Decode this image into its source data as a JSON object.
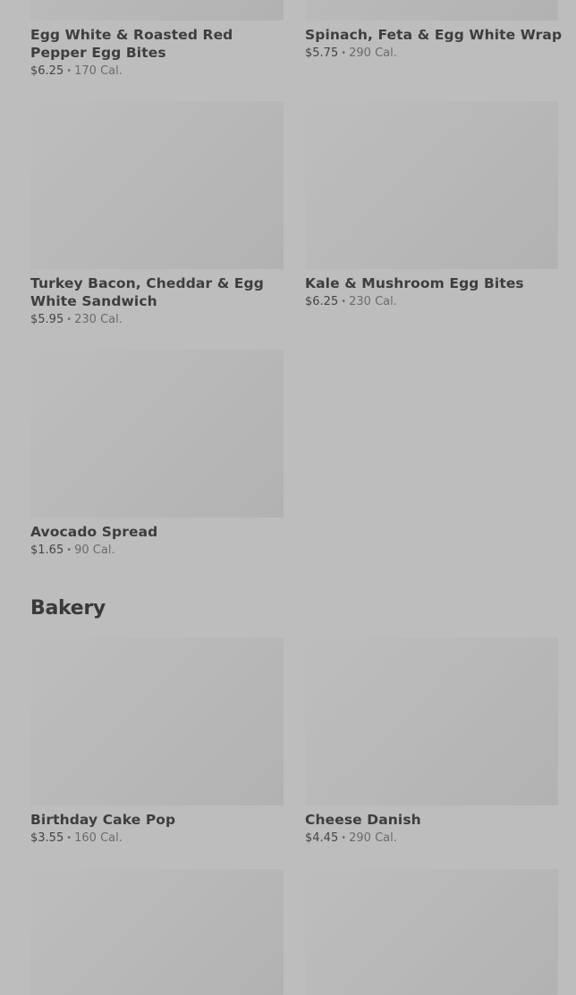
{
  "items_top": [
    {
      "name": "Egg White & Roasted Red Pepper Egg Bites",
      "price": "$6.25",
      "cal": "170 Cal."
    },
    {
      "name": "Spinach, Feta & Egg White Wrap",
      "price": "$5.75",
      "cal": "290 Cal."
    },
    {
      "name": "Turkey Bacon, Cheddar & Egg White Sandwich",
      "price": "$5.95",
      "cal": "230 Cal."
    },
    {
      "name": "Kale & Mushroom Egg Bites",
      "price": "$6.25",
      "cal": "230 Cal."
    },
    {
      "name": "Avocado Spread",
      "price": "$1.65",
      "cal": "90 Cal."
    }
  ],
  "bakery": {
    "title": "Bakery",
    "items": [
      {
        "name": "Birthday Cake Pop",
        "price": "$3.55",
        "cal": "160 Cal."
      },
      {
        "name": "Cheese Danish",
        "price": "$4.45",
        "cal": "290 Cal."
      }
    ]
  },
  "separator": "•"
}
